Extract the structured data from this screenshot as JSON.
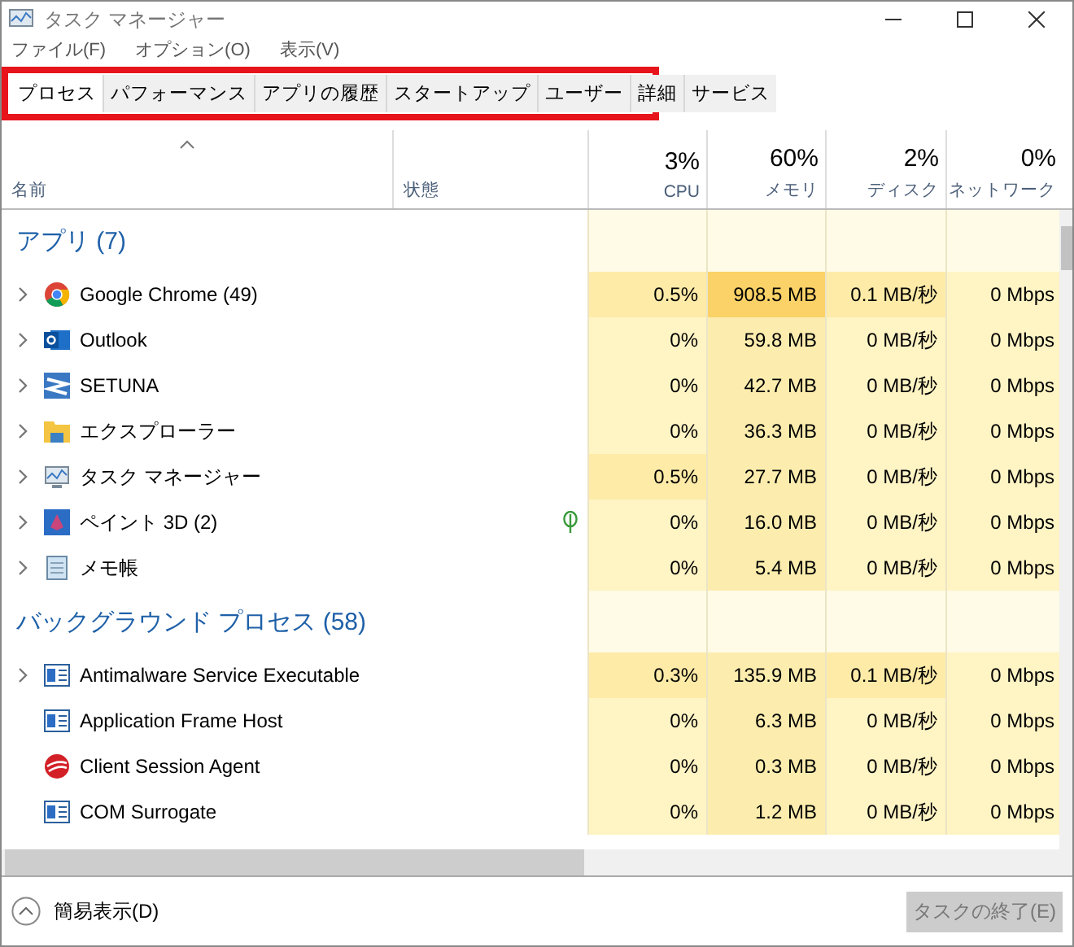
{
  "window": {
    "title": "タスク マネージャー"
  },
  "menu": [
    "ファイル(F)",
    "オプション(O)",
    "表示(V)"
  ],
  "tabs": [
    {
      "label": "プロセス",
      "selected": true
    },
    {
      "label": "パフォーマンス",
      "selected": false
    },
    {
      "label": "アプリの履歴",
      "selected": false
    },
    {
      "label": "スタートアップ",
      "selected": false
    },
    {
      "label": "ユーザー",
      "selected": false
    },
    {
      "label": "詳細",
      "selected": false
    },
    {
      "label": "サービス",
      "selected": false
    }
  ],
  "columns": [
    {
      "label": "名前"
    },
    {
      "label": "状態"
    },
    {
      "percent": "3%",
      "label": "CPU"
    },
    {
      "percent": "60%",
      "label": "メモリ"
    },
    {
      "percent": "2%",
      "label": "ディスク"
    },
    {
      "percent": "0%",
      "label": "ネットワーク"
    }
  ],
  "groups": [
    {
      "title": "アプリ (7)",
      "rows": [
        {
          "name": "Google Chrome (49)",
          "expandable": true,
          "suspended": false,
          "cells": [
            {
              "text": "0.5%",
              "color": "#fdeba7"
            },
            {
              "text": "908.5 MB",
              "color": "#fbd267"
            },
            {
              "text": "0.1 MB/秒",
              "color": "#fdeba7"
            },
            {
              "text": "0 Mbps",
              "color": "#fff4c4"
            }
          ]
        },
        {
          "name": "Outlook",
          "expandable": true,
          "suspended": false,
          "cells": [
            {
              "text": "0%",
              "color": "#fff4c4"
            },
            {
              "text": "59.8 MB",
              "color": "#fcedae"
            },
            {
              "text": "0 MB/秒",
              "color": "#fff4c4"
            },
            {
              "text": "0 Mbps",
              "color": "#fff4c4"
            }
          ]
        },
        {
          "name": "SETUNA",
          "expandable": true,
          "suspended": false,
          "cells": [
            {
              "text": "0%",
              "color": "#fff4c4"
            },
            {
              "text": "42.7 MB",
              "color": "#fcedae"
            },
            {
              "text": "0 MB/秒",
              "color": "#fff4c4"
            },
            {
              "text": "0 Mbps",
              "color": "#fff4c4"
            }
          ]
        },
        {
          "name": "エクスプローラー",
          "expandable": true,
          "suspended": false,
          "cells": [
            {
              "text": "0%",
              "color": "#fff4c4"
            },
            {
              "text": "36.3 MB",
              "color": "#fcedae"
            },
            {
              "text": "0 MB/秒",
              "color": "#fff4c4"
            },
            {
              "text": "0 Mbps",
              "color": "#fff4c4"
            }
          ]
        },
        {
          "name": "タスク マネージャー",
          "expandable": true,
          "suspended": false,
          "cells": [
            {
              "text": "0.5%",
              "color": "#fdeba7"
            },
            {
              "text": "27.7 MB",
              "color": "#fcedae"
            },
            {
              "text": "0 MB/秒",
              "color": "#fff4c4"
            },
            {
              "text": "0 Mbps",
              "color": "#fff4c4"
            }
          ]
        },
        {
          "name": "ペイント 3D (2)",
          "expandable": true,
          "suspended": true,
          "cells": [
            {
              "text": "0%",
              "color": "#fff4c4"
            },
            {
              "text": "16.0 MB",
              "color": "#fcedae"
            },
            {
              "text": "0 MB/秒",
              "color": "#fff4c4"
            },
            {
              "text": "0 Mbps",
              "color": "#fff4c4"
            }
          ]
        },
        {
          "name": "メモ帳",
          "expandable": true,
          "suspended": false,
          "cells": [
            {
              "text": "0%",
              "color": "#fff4c4"
            },
            {
              "text": "5.4 MB",
              "color": "#fcedae"
            },
            {
              "text": "0 MB/秒",
              "color": "#fff4c4"
            },
            {
              "text": "0 Mbps",
              "color": "#fff4c4"
            }
          ]
        }
      ]
    },
    {
      "title": "バックグラウンド プロセス (58)",
      "rows": [
        {
          "name": "Antimalware Service Executable",
          "expandable": true,
          "suspended": false,
          "cells": [
            {
              "text": "0.3%",
              "color": "#fdeba7"
            },
            {
              "text": "135.9 MB",
              "color": "#fcedae"
            },
            {
              "text": "0.1 MB/秒",
              "color": "#fdeba7"
            },
            {
              "text": "0 Mbps",
              "color": "#fff4c4"
            }
          ]
        },
        {
          "name": "Application Frame Host",
          "expandable": false,
          "suspended": false,
          "cells": [
            {
              "text": "0%",
              "color": "#fff4c4"
            },
            {
              "text": "6.3 MB",
              "color": "#fcedae"
            },
            {
              "text": "0 MB/秒",
              "color": "#fff4c4"
            },
            {
              "text": "0 Mbps",
              "color": "#fff4c4"
            }
          ]
        },
        {
          "name": "Client Session Agent",
          "expandable": false,
          "suspended": false,
          "cells": [
            {
              "text": "0%",
              "color": "#fff4c4"
            },
            {
              "text": "0.3 MB",
              "color": "#fcedae"
            },
            {
              "text": "0 MB/秒",
              "color": "#fff4c4"
            },
            {
              "text": "0 Mbps",
              "color": "#fff4c4"
            }
          ]
        },
        {
          "name": "COM Surrogate",
          "expandable": false,
          "suspended": false,
          "cells": [
            {
              "text": "0%",
              "color": "#fff4c4"
            },
            {
              "text": "1.2 MB",
              "color": "#fcedae"
            },
            {
              "text": "0 MB/秒",
              "color": "#fff4c4"
            },
            {
              "text": "0 Mbps",
              "color": "#fff4c4"
            }
          ]
        }
      ]
    }
  ],
  "footer": {
    "toggle": "簡易表示(D)",
    "end_task": {
      "label": "タスクの終了(E)",
      "disabled": true
    }
  }
}
